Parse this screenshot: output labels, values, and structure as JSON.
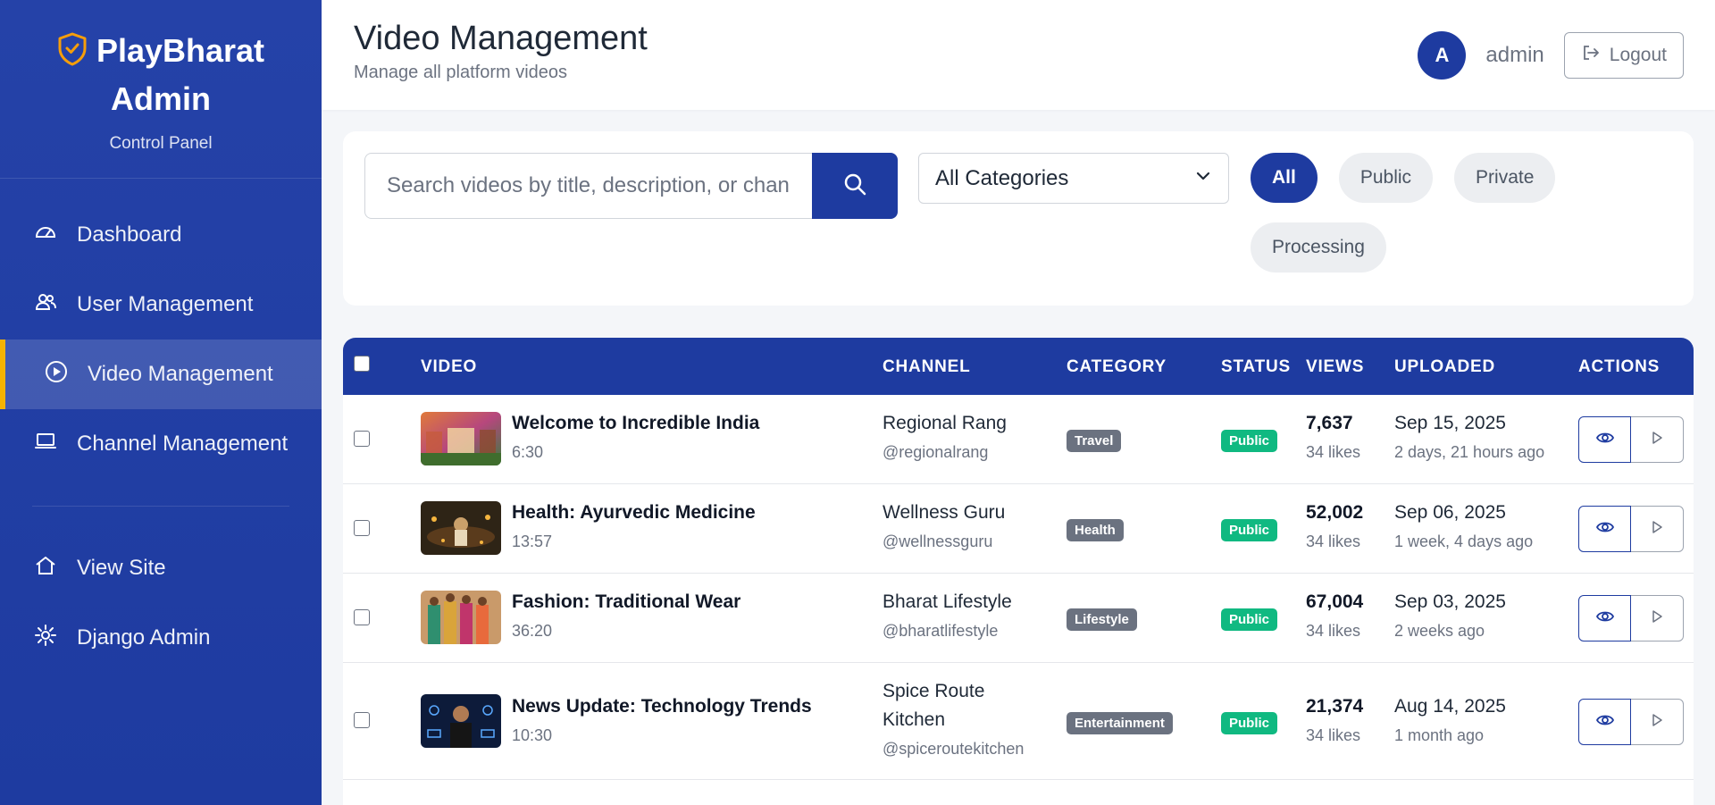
{
  "brand": {
    "name_line1": "PlayBharat",
    "name_line2": "Admin",
    "subtitle": "Control Panel"
  },
  "nav": {
    "dashboard": "Dashboard",
    "users": "User Management",
    "videos": "Video Management",
    "channels": "Channel Management",
    "view_site": "View Site",
    "django_admin": "Django Admin"
  },
  "header": {
    "title": "Video Management",
    "subtitle": "Manage all platform videos"
  },
  "user": {
    "initial": "A",
    "name": "admin",
    "logout_label": "Logout"
  },
  "filters": {
    "search_placeholder": "Search videos by title, description, or channel",
    "category_selected": "All Categories",
    "status_pills": [
      "All",
      "Public",
      "Private",
      "Processing"
    ],
    "active_pill": "All"
  },
  "table": {
    "columns": [
      "VIDEO",
      "CHANNEL",
      "CATEGORY",
      "STATUS",
      "VIEWS",
      "UPLOADED",
      "ACTIONS"
    ],
    "rows": [
      {
        "title": "Welcome to Incredible India",
        "duration": "6:30",
        "channel": "Regional Rang",
        "handle": "@regionalrang",
        "category": "Travel",
        "status": "Public",
        "views": "7,637",
        "likes": "34 likes",
        "date": "Sep 15, 2025",
        "ago": "2 days, 21 hours ago"
      },
      {
        "title": "Health: Ayurvedic Medicine",
        "duration": "13:57",
        "channel": "Wellness Guru",
        "handle": "@wellnessguru",
        "category": "Health",
        "status": "Public",
        "views": "52,002",
        "likes": "34 likes",
        "date": "Sep 06, 2025",
        "ago": "1 week, 4 days ago"
      },
      {
        "title": "Fashion: Traditional Wear",
        "duration": "36:20",
        "channel": "Bharat Lifestyle",
        "handle": "@bharatlifestyle",
        "category": "Lifestyle",
        "status": "Public",
        "views": "67,004",
        "likes": "34 likes",
        "date": "Sep 03, 2025",
        "ago": "2 weeks ago"
      },
      {
        "title": "News Update: Technology Trends",
        "duration": "10:30",
        "channel": "Spice Route Kitchen",
        "handle": "@spiceroutekitchen",
        "category": "Entertainment",
        "status": "Public",
        "views": "21,374",
        "likes": "34 likes",
        "date": "Aug 14, 2025",
        "ago": "1 month ago"
      }
    ]
  },
  "colors": {
    "primary": "#1e3ba0",
    "accent": "#f5b301",
    "public": "#10b981",
    "category": "#6b7280"
  }
}
